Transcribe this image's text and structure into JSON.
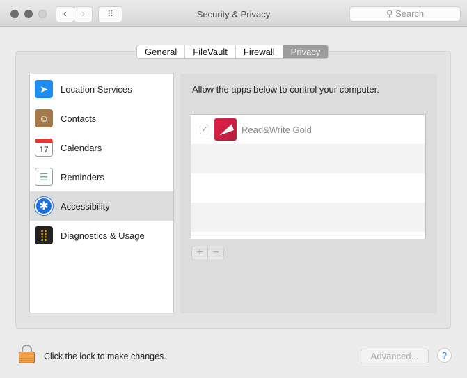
{
  "window": {
    "title": "Security & Privacy",
    "search_placeholder": "Search",
    "back": "‹",
    "forward": "›",
    "grid": "⠿"
  },
  "tabs": [
    {
      "label": "General"
    },
    {
      "label": "FileVault"
    },
    {
      "label": "Firewall"
    },
    {
      "label": "Privacy",
      "selected": true
    }
  ],
  "sidebar": {
    "items": [
      {
        "label": "Location Services",
        "icon": "location-icon",
        "glyph": "➤",
        "color": "#1f8ef0"
      },
      {
        "label": "Contacts",
        "icon": "contacts-icon",
        "glyph": "☺",
        "color": "#a27a4a"
      },
      {
        "label": "Calendars",
        "icon": "calendar-icon",
        "glyph": "17",
        "color": "#ffffff"
      },
      {
        "label": "Reminders",
        "icon": "reminders-icon",
        "glyph": "☰",
        "color": "#ffffff"
      },
      {
        "label": "Accessibility",
        "icon": "accessibility-icon",
        "glyph": "♿",
        "color": "#1f6fe0",
        "selected": true
      },
      {
        "label": "Diagnostics & Usage",
        "icon": "diagnostics-icon",
        "glyph": "⣿",
        "color": "#222222"
      }
    ]
  },
  "panel": {
    "description": "Allow the apps below to control your computer.",
    "apps": [
      {
        "name": "Read&Write Gold",
        "checked": true,
        "check": "✓"
      }
    ],
    "add": "+",
    "remove": "−"
  },
  "footer": {
    "lock_text": "Click the lock to make changes.",
    "advanced": "Advanced...",
    "help": "?"
  }
}
